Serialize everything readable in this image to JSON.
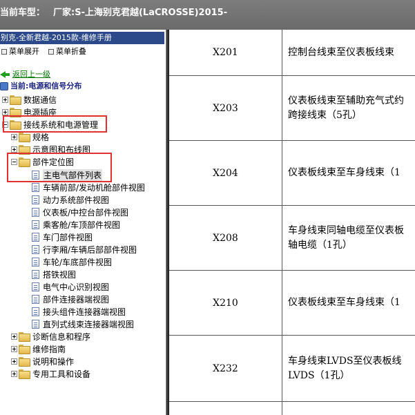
{
  "header": {
    "current_model_label": "当前车型：",
    "manufacturer": "厂家:S-上海别克君越(LaCROSSE)2015-"
  },
  "left_panel": {
    "title": "别克-全新君越-2015款-维修手册",
    "expand_label": "菜单展开",
    "collapse_label": "菜单折叠",
    "back_link": "返回上一级",
    "current_location": "当前:电源和信号分布",
    "tree": [
      {
        "label": "数据通信",
        "type": "folder",
        "expander": "plus"
      },
      {
        "label": "电源插座",
        "type": "folder",
        "expander": "plus"
      },
      {
        "label": "接线系统和电源管理",
        "type": "folder",
        "expander": "minus"
      },
      {
        "label": "规格",
        "type": "folder",
        "expander": "plus"
      },
      {
        "label": "示意图和布线图",
        "type": "folder",
        "expander": "plus"
      },
      {
        "label": "部件定位图",
        "type": "folder",
        "expander": "minus"
      },
      {
        "label": "主电气部件列表",
        "type": "doc",
        "selected": true
      },
      {
        "label": "车辆前部/发动机舱部件视图",
        "type": "doc"
      },
      {
        "label": "动力系统部件视图",
        "type": "doc"
      },
      {
        "label": "仪表板/中控台部件视图",
        "type": "doc"
      },
      {
        "label": "乘客舱/车顶部件视图",
        "type": "doc"
      },
      {
        "label": "车门部件视图",
        "type": "doc"
      },
      {
        "label": "行李厢/车辆后部部件视图",
        "type": "doc"
      },
      {
        "label": "车轮/车底部件视图",
        "type": "doc"
      },
      {
        "label": "搭铁视图",
        "type": "doc"
      },
      {
        "label": "电气中心识别视图",
        "type": "doc"
      },
      {
        "label": "部件连接器端视图",
        "type": "doc"
      },
      {
        "label": "接头组件连接器端视图",
        "type": "doc"
      },
      {
        "label": "直列式线束连接器端视图",
        "type": "doc"
      },
      {
        "label": "诊断信息和程序",
        "type": "folder",
        "expander": "plus"
      },
      {
        "label": "维修指南",
        "type": "folder",
        "expander": "plus"
      },
      {
        "label": "说明和操作",
        "type": "folder",
        "expander": "plus"
      },
      {
        "label": "专用工具和设备",
        "type": "folder",
        "expander": "plus"
      }
    ]
  },
  "table": {
    "rows": [
      {
        "code": "X201",
        "lines": [
          "控制台线束至仪表板线束"
        ]
      },
      {
        "code": "X203",
        "lines": [
          "仪表板线束至辅助充气式约",
          "跨接线束（5孔）"
        ]
      },
      {
        "code": "X204",
        "lines": [
          "仪表板线束至车身线束（1"
        ]
      },
      {
        "code": "X208",
        "lines": [
          "车身线束同轴电缆至仪表板",
          "轴电缆（1孔）"
        ]
      },
      {
        "code": "X210",
        "lines": [
          "仪表板线束至车身线束（1"
        ]
      },
      {
        "code": "X232",
        "lines": [
          "车身线束LVDS至仪表板线",
          "LVDS（1孔）"
        ]
      }
    ]
  }
}
